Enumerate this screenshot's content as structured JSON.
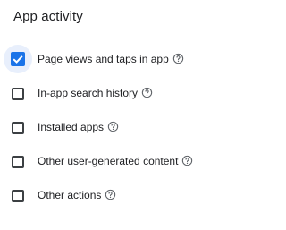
{
  "section": {
    "title": "App activity"
  },
  "options": [
    {
      "label": "Page views and taps in app",
      "checked": true,
      "icon": "help-circle-icon"
    },
    {
      "label": "In-app search history",
      "checked": false,
      "icon": "help-circle-icon"
    },
    {
      "label": "Installed apps",
      "checked": false,
      "icon": "help-circle-icon"
    },
    {
      "label": "Other user-generated content",
      "checked": false,
      "icon": "help-circle-icon"
    },
    {
      "label": "Other actions",
      "checked": false,
      "icon": "help-circle-icon"
    }
  ],
  "colors": {
    "checked_fill": "#1a73e8",
    "checked_halo": "#e8effc",
    "unchecked_border": "#3c4043",
    "text": "#202124",
    "icon": "#5f6368"
  }
}
